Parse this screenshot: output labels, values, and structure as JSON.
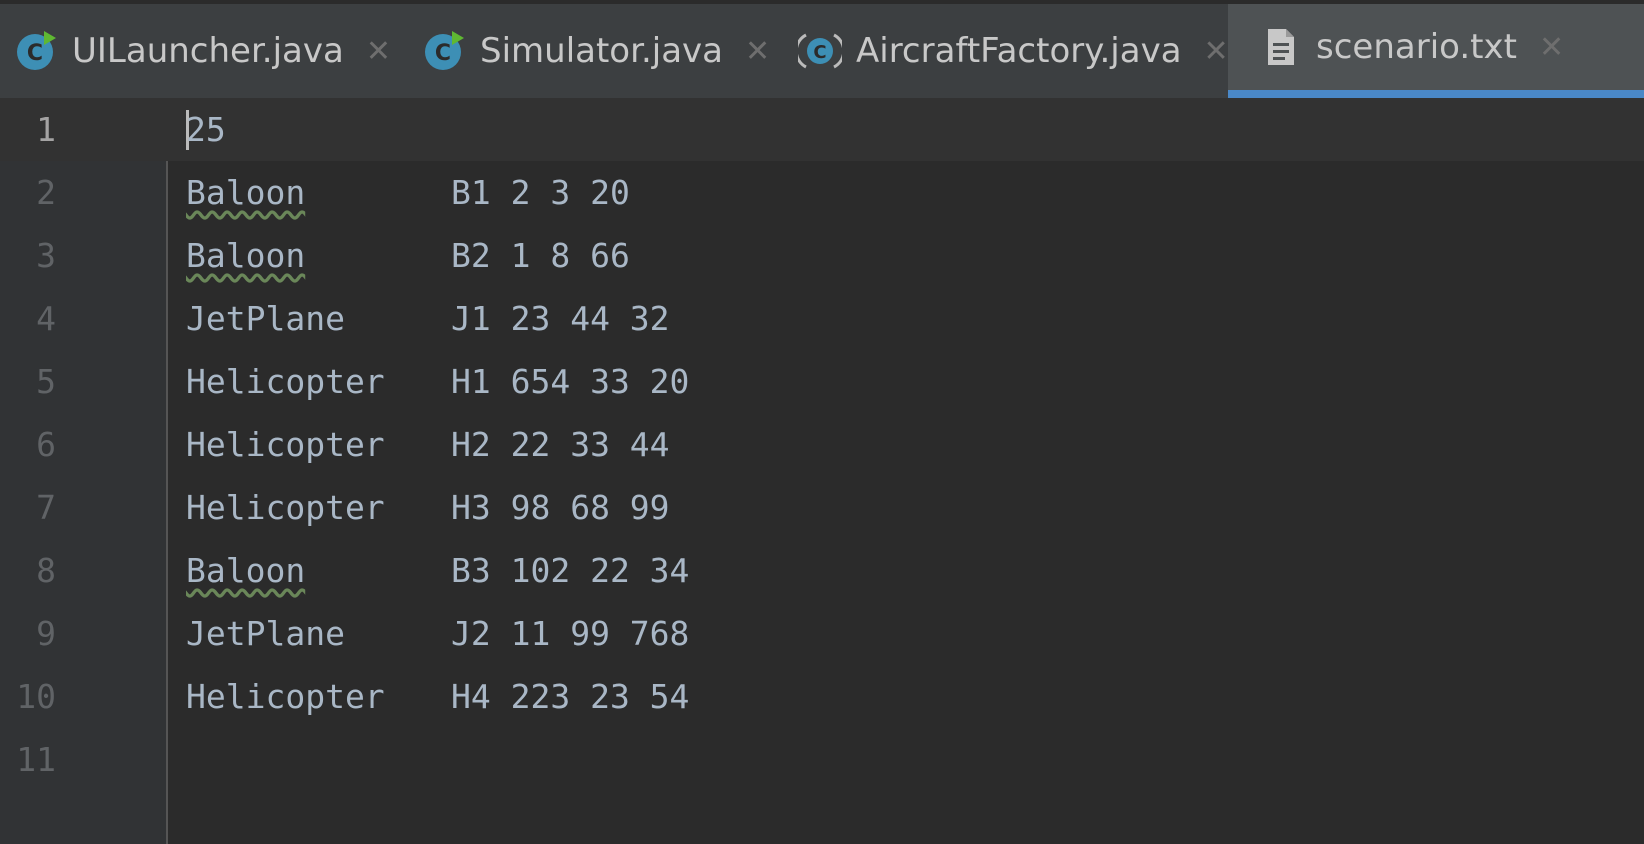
{
  "tabs": [
    {
      "label": "UILauncher.java",
      "icon": "java-class-run-icon",
      "active": false
    },
    {
      "label": "Simulator.java",
      "icon": "java-class-run-icon",
      "active": false
    },
    {
      "label": "AircraftFactory.java",
      "icon": "java-class-icon",
      "active": false
    },
    {
      "label": "scenario.txt",
      "icon": "text-file-icon",
      "active": true
    }
  ],
  "close_glyph": "✕",
  "editor": {
    "lines": [
      {
        "num": "1",
        "type": "25",
        "params": ""
      },
      {
        "num": "2",
        "type": "Baloon",
        "params": "B1 2 3 20"
      },
      {
        "num": "3",
        "type": "Baloon",
        "params": "B2 1 8 66"
      },
      {
        "num": "4",
        "type": "JetPlane",
        "params": "J1 23 44 32"
      },
      {
        "num": "5",
        "type": "Helicopter",
        "params": "H1 654 33 20"
      },
      {
        "num": "6",
        "type": "Helicopter",
        "params": "H2 22 33 44"
      },
      {
        "num": "7",
        "type": "Helicopter",
        "params": "H3 98 68 99"
      },
      {
        "num": "8",
        "type": "Baloon",
        "params": "B3 102 22 34"
      },
      {
        "num": "9",
        "type": "JetPlane",
        "params": "J2 11 99 768"
      },
      {
        "num": "10",
        "type": "Helicopter",
        "params": "H4 223 23 54"
      },
      {
        "num": "11",
        "type": "",
        "params": ""
      }
    ]
  },
  "colors": {
    "accent": "#4a88c7",
    "class_icon": "#3d8fb5",
    "run_badge": "#5fb832",
    "typo_underline": "#6a8759"
  }
}
